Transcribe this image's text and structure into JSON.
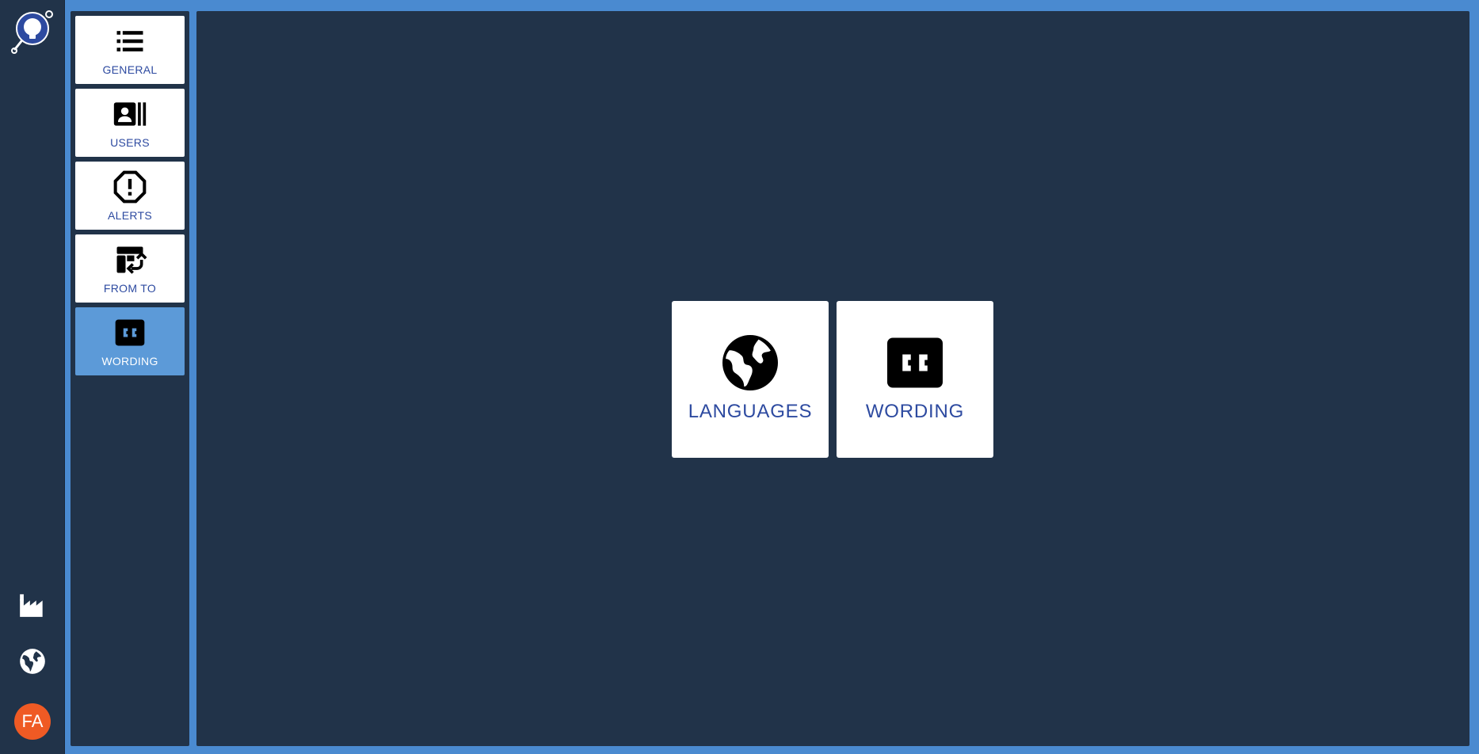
{
  "rail": {
    "logo_icon": "lightbulb-search-logo",
    "bottom_icons": [
      "factory-icon",
      "globe-icon"
    ],
    "avatar_initials": "FA",
    "avatar_color": "#ef5a24"
  },
  "subnav": {
    "items": [
      {
        "label": "GENERAL",
        "icon": "list-icon"
      },
      {
        "label": "USERS",
        "icon": "contact-card-icon"
      },
      {
        "label": "ALERTS",
        "icon": "alert-octagon-icon"
      },
      {
        "label": "FROM TO",
        "icon": "table-swap-icon"
      },
      {
        "label": "WORDING",
        "icon": "closed-caption-icon",
        "active": true
      }
    ]
  },
  "main": {
    "cards": [
      {
        "label": "LANGUAGES",
        "icon": "globe-icon"
      },
      {
        "label": "WORDING",
        "icon": "closed-caption-icon"
      }
    ]
  },
  "colors": {
    "background": "#213349",
    "frame": "#4a8ad0",
    "active_item": "#5c9ad8",
    "label_text": "#2d4aa0"
  }
}
